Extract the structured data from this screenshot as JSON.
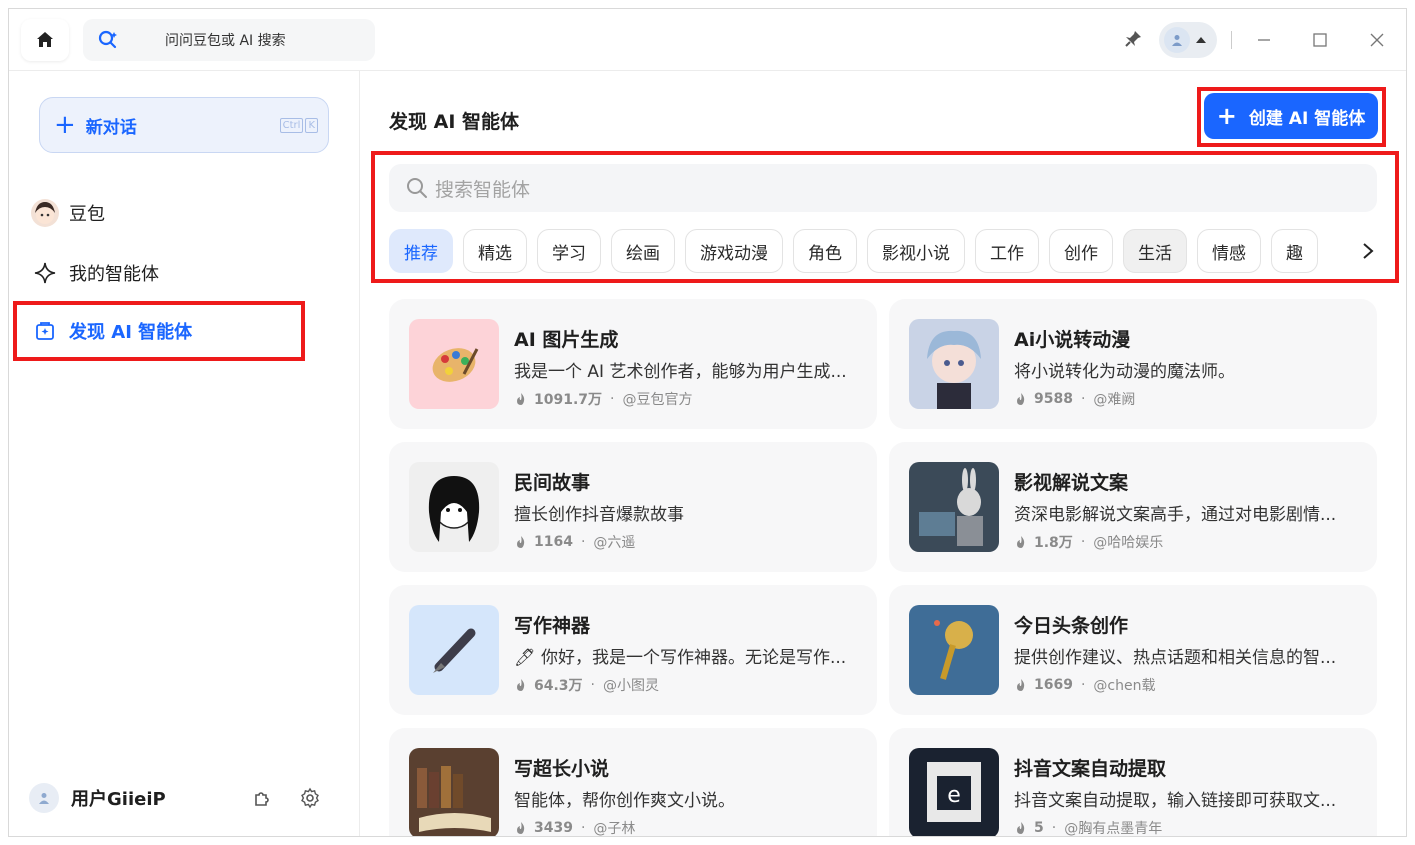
{
  "titlebar": {
    "search_placeholder": "问问豆包或 AI 搜索"
  },
  "sidebar": {
    "new_chat_label": "新对话",
    "shortcut_ctrl": "Ctrl",
    "shortcut_key": "K",
    "items": [
      {
        "label": "豆包"
      },
      {
        "label": "我的智能体"
      },
      {
        "label": "发现 AI 智能体"
      }
    ],
    "user_name": "用户GiieiP"
  },
  "main": {
    "title": "发现 AI 智能体",
    "create_button": "创建 AI 智能体",
    "search_placeholder": "搜索智能体",
    "tabs": [
      "推荐",
      "精选",
      "学习",
      "绘画",
      "游戏动漫",
      "角色",
      "影视小说",
      "工作",
      "创作",
      "生活",
      "情感",
      "趣"
    ],
    "active_tab": "推荐",
    "cards": [
      {
        "title": "AI 图片生成",
        "desc": "我是一个 AI 艺术创作者，能够为用户生成...",
        "count": "1091.7万",
        "author": "@豆包官方",
        "thumb": "palette-icon",
        "bg": "#fdd3d8"
      },
      {
        "title": "Ai小说转动漫",
        "desc": "将小说转化为动漫的魔法师。",
        "count": "9588",
        "author": "@难阙",
        "thumb": "anime-girl-image",
        "bg": "#c9d3e6"
      },
      {
        "title": "民间故事",
        "desc": "擅长创作抖音爆款故事",
        "count": "1164",
        "author": "@六遥",
        "thumb": "sketch-girl-image",
        "bg": "#efefef"
      },
      {
        "title": "影视解说文案",
        "desc": "资深电影解说文案高手，通过对电影剧情...",
        "count": "1.8万",
        "author": "@哈哈娱乐",
        "thumb": "rabbit-editor-image",
        "bg": "#3b4a58"
      },
      {
        "title": "写作神器",
        "desc": "🖊 你好，我是一个写作神器。无论是写作...",
        "count": "64.3万",
        "author": "@小图灵",
        "thumb": "fountain-pen-icon",
        "bg": "#d5e6fb"
      },
      {
        "title": "今日头条创作",
        "desc": "提供创作建议、热点话题和相关信息的智...",
        "count": "1669",
        "author": "@chen载",
        "thumb": "microphone-image",
        "bg": "#3f6d97"
      },
      {
        "title": "写超长小说",
        "desc": "智能体，帮你创作爽文小说。",
        "count": "3439",
        "author": "@子林",
        "thumb": "books-image",
        "bg": "#5a4030"
      },
      {
        "title": "抖音文案自动提取",
        "desc": "抖音文案自动提取，输入链接即可获取文...",
        "count": "5",
        "author": "@胸有点墨青年",
        "thumb": "screen-logo-image",
        "bg": "#1a2230"
      }
    ]
  },
  "colors": {
    "accent": "#1a66ff",
    "annotation": "#ee1a1a"
  }
}
